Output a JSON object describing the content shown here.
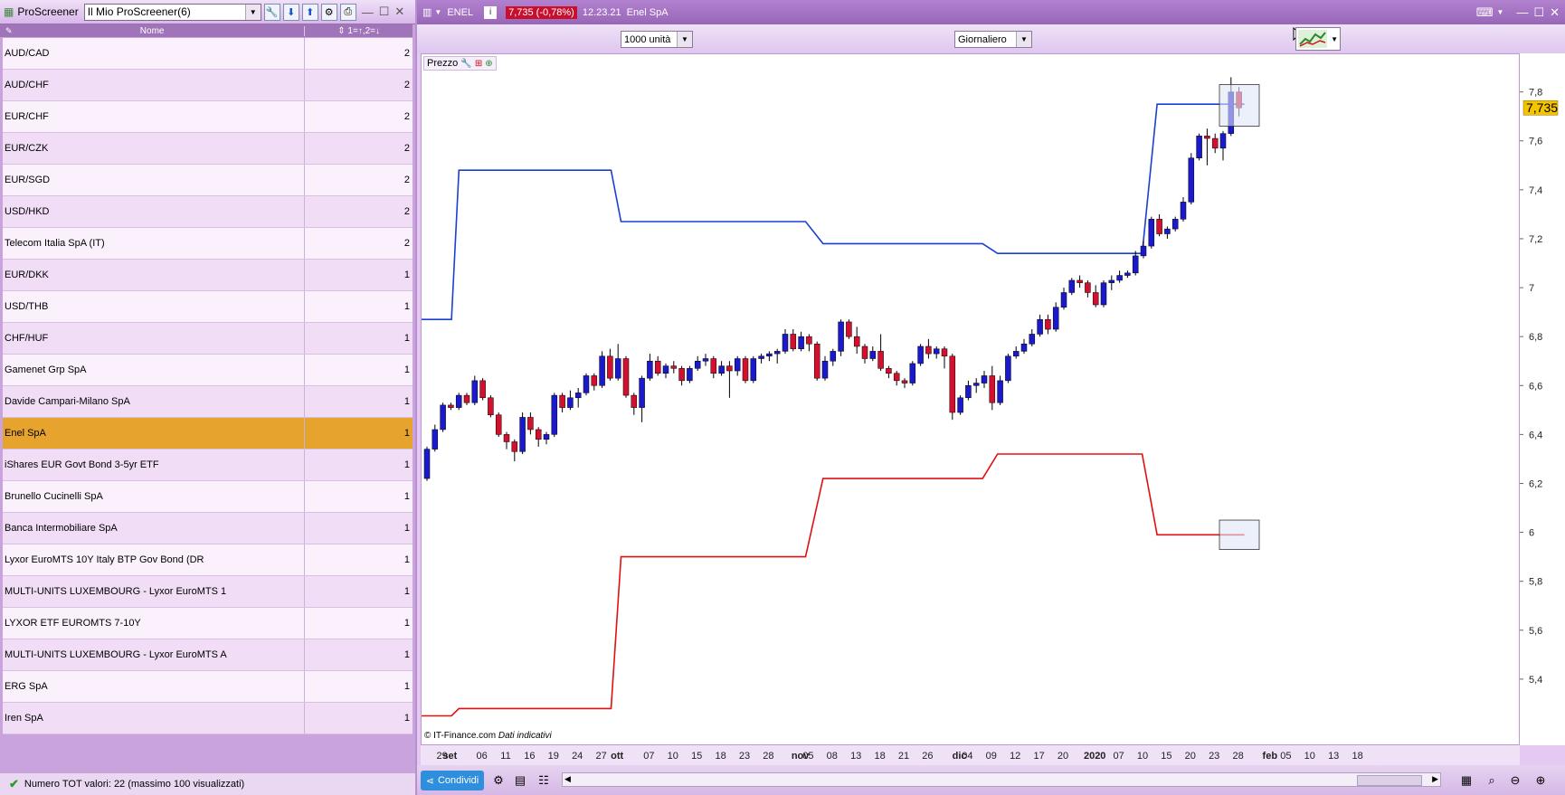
{
  "left_panel": {
    "app_title": "ProScreener",
    "screener_name": "Il Mio ProScreener(6)",
    "columns": {
      "name": "Nome",
      "value": "1=↑,2=↓"
    },
    "rows": [
      {
        "name": "AUD/CAD",
        "value": "2"
      },
      {
        "name": "AUD/CHF",
        "value": "2"
      },
      {
        "name": "EUR/CHF",
        "value": "2"
      },
      {
        "name": "EUR/CZK",
        "value": "2"
      },
      {
        "name": "EUR/SGD",
        "value": "2"
      },
      {
        "name": "USD/HKD",
        "value": "2"
      },
      {
        "name": "Telecom Italia SpA (IT)",
        "value": "2"
      },
      {
        "name": "EUR/DKK",
        "value": "1"
      },
      {
        "name": "USD/THB",
        "value": "1"
      },
      {
        "name": "CHF/HUF",
        "value": "1"
      },
      {
        "name": "Gamenet Grp SpA",
        "value": "1"
      },
      {
        "name": "Davide Campari-Milano SpA",
        "value": "1"
      },
      {
        "name": "Enel SpA",
        "value": "1"
      },
      {
        "name": "iShares EUR Govt Bond 3-5yr ETF",
        "value": "1"
      },
      {
        "name": "Brunello Cucinelli SpA",
        "value": "1"
      },
      {
        "name": "Banca Intermobiliare SpA",
        "value": "1"
      },
      {
        "name": "Lyxor EuroMTS 10Y Italy BTP Gov Bond (DR",
        "value": "1"
      },
      {
        "name": "MULTI-UNITS LUXEMBOURG - Lyxor EuroMTS 1",
        "value": "1"
      },
      {
        "name": "LYXOR ETF EUROMTS 7-10Y",
        "value": "1"
      },
      {
        "name": "MULTI-UNITS LUXEMBOURG - Lyxor EuroMTS A",
        "value": "1"
      },
      {
        "name": "ERG SpA",
        "value": "1"
      },
      {
        "name": "Iren SpA",
        "value": "1"
      }
    ],
    "selected_row": 12,
    "status": "Numero TOT valori: 22 (massimo 100 visualizzati)"
  },
  "chart_window": {
    "ticker": "ENEL",
    "price_change": "7,735 (-0,78%)",
    "time": "12.23.21",
    "instrument_name": "Enel SpA",
    "units_select": "1000 unità",
    "period_select": "Giornaliero",
    "price_panel_label": "Prezzo",
    "copyright": "© IT-Finance.com",
    "copyright_note": "Dati indicativi",
    "share_button": "Condividi",
    "current_price_label": "7,735"
  },
  "colors": {
    "bull": "#1a1acc",
    "bear": "#d4102e",
    "upper_band": "#1a3fd4",
    "lower_band": "#e01010",
    "selected_row": "#e6a32e"
  },
  "chart_data": {
    "type": "candlestick",
    "y_ticks": [
      "5,4",
      "5,6",
      "5,8",
      "6",
      "6,2",
      "6,4",
      "6,6",
      "6,8",
      "7",
      "7,2",
      "7,4",
      "7,6",
      "7,8"
    ],
    "ylim": [
      5.2,
      7.88
    ],
    "x_tick_labels": [
      {
        "i": 2,
        "label": "29"
      },
      {
        "i": 3,
        "label": "set"
      },
      {
        "i": 7,
        "label": "06"
      },
      {
        "i": 10,
        "label": "11"
      },
      {
        "i": 13,
        "label": "16"
      },
      {
        "i": 16,
        "label": "19"
      },
      {
        "i": 19,
        "label": "24"
      },
      {
        "i": 22,
        "label": "27"
      },
      {
        "i": 24,
        "label": "ott"
      },
      {
        "i": 28,
        "label": "07"
      },
      {
        "i": 31,
        "label": "10"
      },
      {
        "i": 34,
        "label": "15"
      },
      {
        "i": 37,
        "label": "18"
      },
      {
        "i": 40,
        "label": "23"
      },
      {
        "i": 43,
        "label": "28"
      },
      {
        "i": 47,
        "label": "nov"
      },
      {
        "i": 48,
        "label": "05"
      },
      {
        "i": 51,
        "label": "08"
      },
      {
        "i": 54,
        "label": "13"
      },
      {
        "i": 57,
        "label": "18"
      },
      {
        "i": 60,
        "label": "21"
      },
      {
        "i": 63,
        "label": "26"
      },
      {
        "i": 67,
        "label": "dic"
      },
      {
        "i": 68,
        "label": "04"
      },
      {
        "i": 71,
        "label": "09"
      },
      {
        "i": 74,
        "label": "12"
      },
      {
        "i": 77,
        "label": "17"
      },
      {
        "i": 80,
        "label": "20"
      },
      {
        "i": 84,
        "label": "2020"
      },
      {
        "i": 87,
        "label": "07"
      },
      {
        "i": 90,
        "label": "10"
      },
      {
        "i": 93,
        "label": "15"
      },
      {
        "i": 96,
        "label": "20"
      },
      {
        "i": 99,
        "label": "23"
      },
      {
        "i": 102,
        "label": "28"
      },
      {
        "i": 106,
        "label": "feb"
      },
      {
        "i": 108,
        "label": "05"
      },
      {
        "i": 111,
        "label": "10"
      },
      {
        "i": 114,
        "label": "13"
      },
      {
        "i": 117,
        "label": "18"
      }
    ],
    "candles": [
      [
        6.22,
        6.35,
        6.21,
        6.34
      ],
      [
        6.34,
        6.44,
        6.33,
        6.42
      ],
      [
        6.42,
        6.53,
        6.41,
        6.52
      ],
      [
        6.52,
        6.53,
        6.5,
        6.51
      ],
      [
        6.51,
        6.57,
        6.5,
        6.56
      ],
      [
        6.56,
        6.57,
        6.52,
        6.53
      ],
      [
        6.53,
        6.64,
        6.52,
        6.62
      ],
      [
        6.62,
        6.63,
        6.54,
        6.55
      ],
      [
        6.55,
        6.56,
        6.47,
        6.48
      ],
      [
        6.48,
        6.49,
        6.39,
        6.4
      ],
      [
        6.4,
        6.41,
        6.34,
        6.37
      ],
      [
        6.37,
        6.38,
        6.29,
        6.33
      ],
      [
        6.33,
        6.49,
        6.32,
        6.47
      ],
      [
        6.47,
        6.49,
        6.4,
        6.42
      ],
      [
        6.42,
        6.43,
        6.35,
        6.38
      ],
      [
        6.38,
        6.41,
        6.36,
        6.4
      ],
      [
        6.4,
        6.57,
        6.39,
        6.56
      ],
      [
        6.56,
        6.57,
        6.49,
        6.51
      ],
      [
        6.51,
        6.58,
        6.5,
        6.55
      ],
      [
        6.55,
        6.59,
        6.51,
        6.57
      ],
      [
        6.57,
        6.65,
        6.56,
        6.64
      ],
      [
        6.64,
        6.65,
        6.58,
        6.6
      ],
      [
        6.6,
        6.74,
        6.59,
        6.72
      ],
      [
        6.72,
        6.75,
        6.62,
        6.63
      ],
      [
        6.63,
        6.77,
        6.62,
        6.71
      ],
      [
        6.71,
        6.72,
        6.55,
        6.56
      ],
      [
        6.56,
        6.57,
        6.48,
        6.51
      ],
      [
        6.51,
        6.64,
        6.45,
        6.63
      ],
      [
        6.63,
        6.73,
        6.62,
        6.7
      ],
      [
        6.7,
        6.72,
        6.64,
        6.65
      ],
      [
        6.65,
        6.69,
        6.63,
        6.68
      ],
      [
        6.68,
        6.7,
        6.65,
        6.67
      ],
      [
        6.67,
        6.68,
        6.6,
        6.62
      ],
      [
        6.62,
        6.68,
        6.61,
        6.67
      ],
      [
        6.67,
        6.72,
        6.66,
        6.7
      ],
      [
        6.7,
        6.73,
        6.68,
        6.71
      ],
      [
        6.71,
        6.72,
        6.63,
        6.65
      ],
      [
        6.65,
        6.7,
        6.64,
        6.68
      ],
      [
        6.68,
        6.7,
        6.55,
        6.66
      ],
      [
        6.66,
        6.72,
        6.64,
        6.71
      ],
      [
        6.71,
        6.72,
        6.61,
        6.62
      ],
      [
        6.62,
        6.72,
        6.61,
        6.71
      ],
      [
        6.71,
        6.73,
        6.69,
        6.72
      ],
      [
        6.72,
        6.74,
        6.7,
        6.73
      ],
      [
        6.73,
        6.75,
        6.69,
        6.74
      ],
      [
        6.74,
        6.83,
        6.73,
        6.81
      ],
      [
        6.81,
        6.83,
        6.74,
        6.75
      ],
      [
        6.75,
        6.82,
        6.74,
        6.8
      ],
      [
        6.8,
        6.81,
        6.74,
        6.77
      ],
      [
        6.77,
        6.78,
        6.62,
        6.63
      ],
      [
        6.63,
        6.72,
        6.62,
        6.7
      ],
      [
        6.7,
        6.75,
        6.68,
        6.74
      ],
      [
        6.74,
        6.87,
        6.72,
        6.86
      ],
      [
        6.86,
        6.87,
        6.79,
        6.8
      ],
      [
        6.8,
        6.84,
        6.73,
        6.76
      ],
      [
        6.76,
        6.77,
        6.69,
        6.71
      ],
      [
        6.71,
        6.76,
        6.7,
        6.74
      ],
      [
        6.74,
        6.81,
        6.66,
        6.67
      ],
      [
        6.67,
        6.68,
        6.63,
        6.65
      ],
      [
        6.65,
        6.66,
        6.6,
        6.62
      ],
      [
        6.62,
        6.63,
        6.59,
        6.61
      ],
      [
        6.61,
        6.7,
        6.6,
        6.69
      ],
      [
        6.69,
        6.77,
        6.68,
        6.76
      ],
      [
        6.76,
        6.79,
        6.71,
        6.73
      ],
      [
        6.73,
        6.76,
        6.71,
        6.75
      ],
      [
        6.75,
        6.76,
        6.67,
        6.72
      ],
      [
        6.72,
        6.73,
        6.46,
        6.49
      ],
      [
        6.49,
        6.56,
        6.48,
        6.55
      ],
      [
        6.55,
        6.62,
        6.54,
        6.6
      ],
      [
        6.6,
        6.63,
        6.57,
        6.61
      ],
      [
        6.61,
        6.66,
        6.59,
        6.64
      ],
      [
        6.64,
        6.68,
        6.5,
        6.53
      ],
      [
        6.53,
        6.64,
        6.52,
        6.62
      ],
      [
        6.62,
        6.73,
        6.61,
        6.72
      ],
      [
        6.72,
        6.76,
        6.71,
        6.74
      ],
      [
        6.74,
        6.79,
        6.73,
        6.77
      ],
      [
        6.77,
        6.83,
        6.76,
        6.81
      ],
      [
        6.81,
        6.89,
        6.8,
        6.87
      ],
      [
        6.87,
        6.89,
        6.81,
        6.83
      ],
      [
        6.83,
        6.94,
        6.82,
        6.92
      ],
      [
        6.92,
        7.0,
        6.91,
        6.98
      ],
      [
        6.98,
        7.04,
        6.97,
        7.03
      ],
      [
        7.03,
        7.05,
        7.0,
        7.02
      ],
      [
        7.02,
        7.03,
        6.96,
        6.98
      ],
      [
        6.98,
        7.01,
        6.92,
        6.93
      ],
      [
        6.93,
        7.03,
        6.92,
        7.02
      ],
      [
        7.02,
        7.05,
        6.99,
        7.03
      ],
      [
        7.03,
        7.07,
        7.02,
        7.05
      ],
      [
        7.05,
        7.07,
        7.04,
        7.06
      ],
      [
        7.06,
        7.15,
        7.05,
        7.13
      ],
      [
        7.13,
        7.19,
        7.12,
        7.17
      ],
      [
        7.17,
        7.29,
        7.16,
        7.28
      ],
      [
        7.28,
        7.3,
        7.21,
        7.22
      ],
      [
        7.22,
        7.25,
        7.2,
        7.24
      ],
      [
        7.24,
        7.29,
        7.23,
        7.28
      ],
      [
        7.28,
        7.37,
        7.27,
        7.35
      ],
      [
        7.35,
        7.55,
        7.34,
        7.53
      ],
      [
        7.53,
        7.63,
        7.52,
        7.62
      ],
      [
        7.62,
        7.65,
        7.5,
        7.61
      ],
      [
        7.61,
        7.63,
        7.55,
        7.57
      ],
      [
        7.57,
        7.64,
        7.52,
        7.63
      ],
      [
        7.63,
        7.86,
        7.62,
        7.8
      ],
      [
        7.8,
        7.82,
        7.7,
        7.735
      ]
    ],
    "upper_band": [
      [
        0,
        6.87
      ],
      [
        12,
        6.87
      ],
      [
        15,
        7.48
      ],
      [
        76,
        7.48
      ],
      [
        80,
        7.27
      ],
      [
        154,
        7.27
      ],
      [
        161,
        7.18
      ],
      [
        225,
        7.18
      ],
      [
        231,
        7.14
      ],
      [
        289,
        7.14
      ],
      [
        295,
        7.75
      ],
      [
        330,
        7.75
      ]
    ],
    "lower_band": [
      [
        0,
        5.25
      ],
      [
        12,
        5.25
      ],
      [
        15,
        5.28
      ],
      [
        76,
        5.28
      ],
      [
        80,
        5.9
      ],
      [
        154,
        5.9
      ],
      [
        161,
        6.22
      ],
      [
        225,
        6.22
      ],
      [
        231,
        6.32
      ],
      [
        289,
        6.32
      ],
      [
        295,
        5.99
      ],
      [
        330,
        5.99
      ]
    ],
    "band_x_domain": [
      0,
      330
    ]
  }
}
